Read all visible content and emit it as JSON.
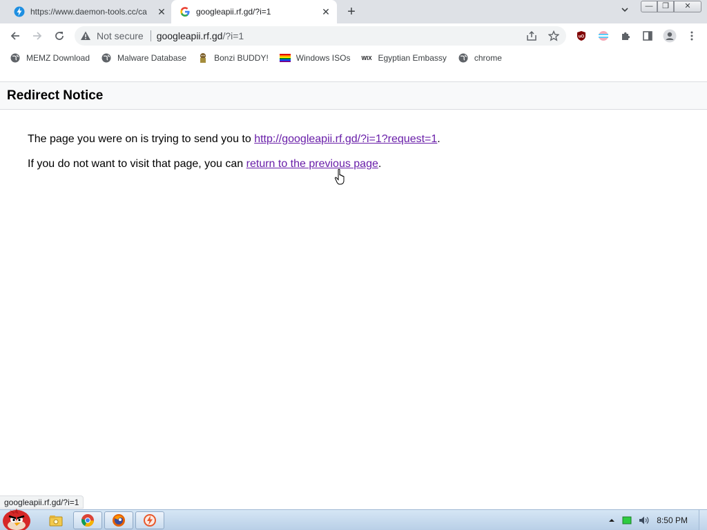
{
  "browser": {
    "tabs": [
      {
        "title": "https://www.daemon-tools.cc/ca",
        "favicon": "daemon-tools-bolt-icon",
        "active": false
      },
      {
        "title": "googleapii.rf.gd/?i=1",
        "favicon": "google-g-icon",
        "active": true
      }
    ],
    "new_tab_label": "+",
    "window_controls": {
      "minimize": "—",
      "maximize": "❐",
      "close": "✕"
    },
    "toolbar": {
      "security_label": "Not secure",
      "url_host": "googleapii.rf.gd",
      "url_path": "/?i=1"
    },
    "bookmarks": [
      {
        "label": "MEMZ Download",
        "icon": "globe-icon"
      },
      {
        "label": "Malware Database",
        "icon": "globe-icon"
      },
      {
        "label": "Bonzi BUDDY!",
        "icon": "bonzi-icon"
      },
      {
        "label": "Windows ISOs",
        "icon": "rainbow-flag-icon"
      },
      {
        "label": "Egyptian Embassy",
        "icon": "wix-icon"
      },
      {
        "label": "chrome",
        "icon": "globe-icon"
      }
    ],
    "status_bubble": "googleapii.rf.gd/?i=1"
  },
  "page": {
    "title": "Redirect Notice",
    "line1_prefix": "The page you were on is trying to send you to ",
    "line1_link": "http://googleapii.rf.gd/?i=1?request=1",
    "line1_suffix": ".",
    "line2_prefix": "If you do not want to visit that page, you can ",
    "line2_link": "return to the previous page",
    "line2_suffix": "."
  },
  "taskbar": {
    "clock": "8:50 PM",
    "apps": [
      {
        "name": "file-explorer-icon",
        "active": false
      },
      {
        "name": "chrome-icon",
        "active": true
      },
      {
        "name": "firefox-like-icon",
        "active": true
      },
      {
        "name": "daemon-tools-icon",
        "active": true
      }
    ]
  },
  "colors": {
    "tabstrip": "#dee1e6",
    "link_visited": "#681da8",
    "taskbar": "#c4d8ee"
  }
}
